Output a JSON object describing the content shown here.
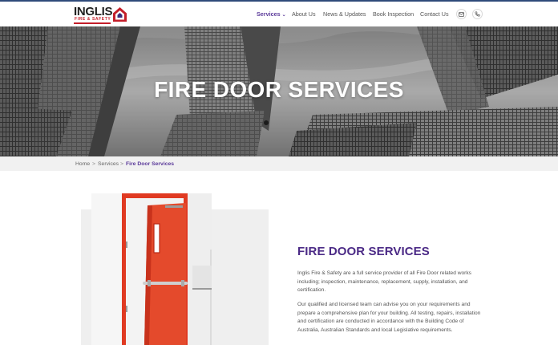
{
  "brand": {
    "logo_word": "INGLIS",
    "logo_sub": "FIRE & SAFETY",
    "colors": {
      "brand_red": "#c41e2a",
      "accent_purple": "#5b3a9a",
      "title_purple": "#4b2a86",
      "top_line": "#2e4a7a"
    }
  },
  "nav": {
    "items": [
      {
        "label": "Services",
        "active": true,
        "has_dropdown": true
      },
      {
        "label": "About Us"
      },
      {
        "label": "News & Updates"
      },
      {
        "label": "Book Inspection"
      },
      {
        "label": "Contact Us"
      }
    ],
    "icons": [
      "mail-icon",
      "phone-icon"
    ]
  },
  "hero": {
    "title": "FIRE DOOR SERVICES"
  },
  "breadcrumb": {
    "items": [
      "Home",
      "Services",
      "Fire Door Services"
    ],
    "separator": ">"
  },
  "content": {
    "title": "FIRE DOOR SERVICES",
    "paragraphs": [
      "Inglis Fire & Safety are a full service provider of all Fire Door related works including; inspection, maintenance, replacement, supply, installation, and certification.",
      "Our qualified and licensed team can advise you on your requirements and prepare a comprehensive plan for your building. All testing, repairs, installation and certification are conducted in accordance with the Building Code of Australia, Australian Standards and local Legislative requirements."
    ]
  }
}
